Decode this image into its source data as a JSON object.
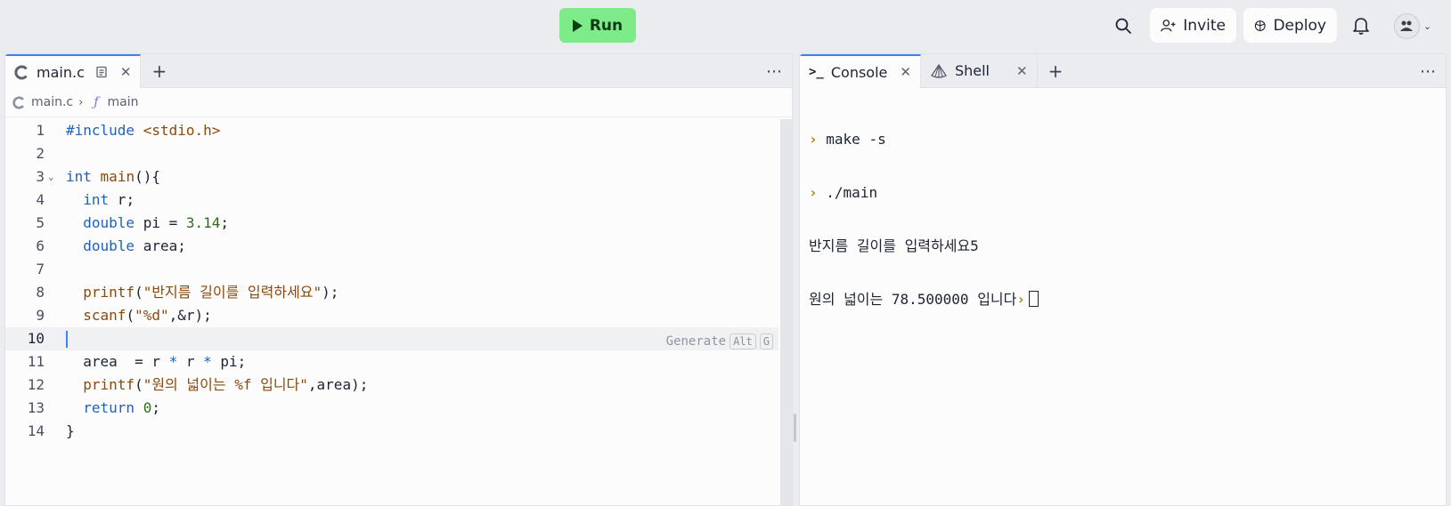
{
  "topbar": {
    "run_label": "Run",
    "invite_label": "Invite",
    "deploy_label": "Deploy"
  },
  "editor": {
    "tab_label": "main.c",
    "breadcrumb_file": "main.c",
    "breadcrumb_symbol": "main",
    "generate_hint": "Generate",
    "generate_key1": "Alt",
    "generate_key2": "G",
    "active_line": 10
  },
  "console": {
    "tab_console": "Console",
    "tab_shell": "Shell",
    "lines": [
      {
        "prompt": true,
        "text": "make -s"
      },
      {
        "prompt": true,
        "text": "./main"
      },
      {
        "prompt": false,
        "text": "반지름 길이를 입력하세요5"
      },
      {
        "prompt": false,
        "text": "원의 넓이는 78.500000 입니다"
      }
    ]
  },
  "colors": {
    "run_button": "#7deb88",
    "accent": "#3b82f6",
    "keyword": "#1f63b6",
    "string": "#8a4a0b",
    "number": "#2f6b1e"
  }
}
